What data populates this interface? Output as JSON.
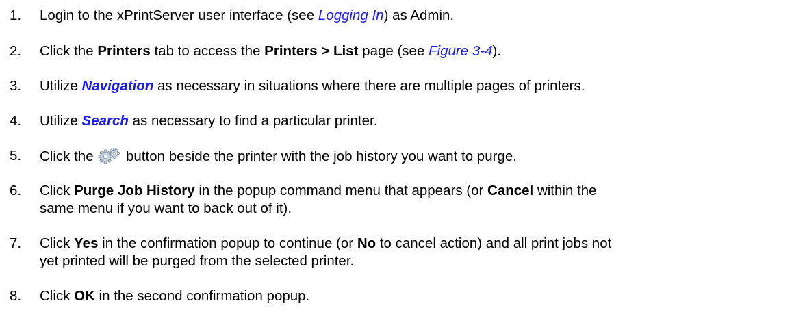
{
  "steps": [
    {
      "number": "1.",
      "pre": "Login to the xPrintServer user interface (see ",
      "link": "Logging In",
      "post": ") as Admin."
    },
    {
      "number": "2.",
      "pre": "Click the ",
      "bold1": "Printers",
      "mid": " tab to access the ",
      "bold2": "Printers > List",
      "mid2": " page (see ",
      "link": "Figure 3-4",
      "post": ")."
    },
    {
      "number": "3.",
      "pre": "Utilize ",
      "link": "Navigation",
      "post": " as necessary in situations where there are multiple pages of printers."
    },
    {
      "number": "4.",
      "pre": "Utilize ",
      "link": "Search",
      "post": " as necessary to find a particular printer."
    },
    {
      "number": "5.",
      "pre": "Click the ",
      "icon": "gear-icon",
      "post": " button beside the printer with the job history you want to purge."
    },
    {
      "number": "6.",
      "pre": "Click ",
      "bold1": "Purge Job History",
      "mid": " in the popup command menu that appears (or ",
      "bold2": "Cancel",
      "mid2": " within the",
      "line2": "same menu if you want to back out of it)."
    },
    {
      "number": "7.",
      "pre": "Click ",
      "bold1": "Yes",
      "mid": " in the confirmation popup to continue (or ",
      "bold2": "No",
      "mid2": " to cancel action) and all print jobs not",
      "line2": "yet printed will be purged from the selected printer."
    },
    {
      "number": "8.",
      "pre": "Click ",
      "bold1": "OK",
      "post": " in the second confirmation popup."
    }
  ],
  "colors": {
    "link": "#1a1aff",
    "gear_light": "#c9d6e0",
    "gear_dark": "#6e8496"
  }
}
